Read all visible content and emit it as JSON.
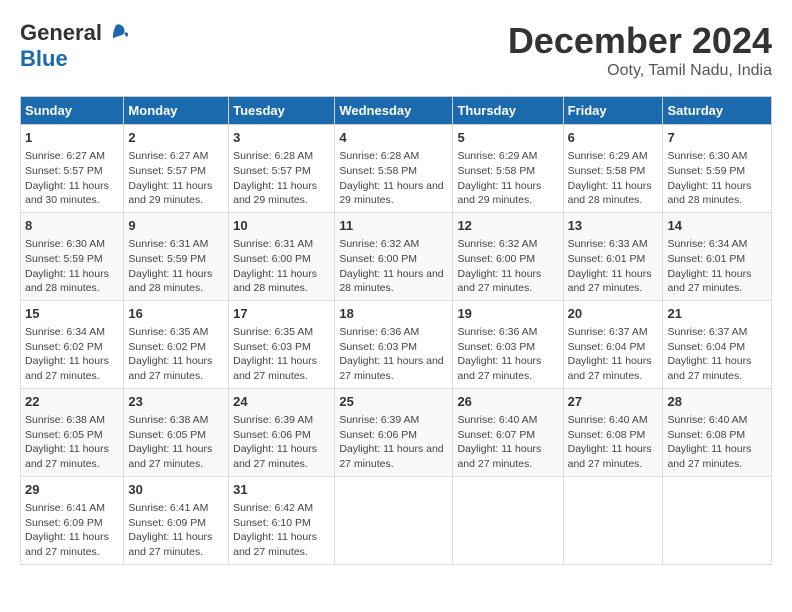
{
  "logo": {
    "general": "General",
    "blue": "Blue"
  },
  "title": "December 2024",
  "location": "Ooty, Tamil Nadu, India",
  "days_of_week": [
    "Sunday",
    "Monday",
    "Tuesday",
    "Wednesday",
    "Thursday",
    "Friday",
    "Saturday"
  ],
  "weeks": [
    [
      {
        "day": "1",
        "sunrise": "Sunrise: 6:27 AM",
        "sunset": "Sunset: 5:57 PM",
        "daylight": "Daylight: 11 hours and 30 minutes."
      },
      {
        "day": "2",
        "sunrise": "Sunrise: 6:27 AM",
        "sunset": "Sunset: 5:57 PM",
        "daylight": "Daylight: 11 hours and 29 minutes."
      },
      {
        "day": "3",
        "sunrise": "Sunrise: 6:28 AM",
        "sunset": "Sunset: 5:57 PM",
        "daylight": "Daylight: 11 hours and 29 minutes."
      },
      {
        "day": "4",
        "sunrise": "Sunrise: 6:28 AM",
        "sunset": "Sunset: 5:58 PM",
        "daylight": "Daylight: 11 hours and 29 minutes."
      },
      {
        "day": "5",
        "sunrise": "Sunrise: 6:29 AM",
        "sunset": "Sunset: 5:58 PM",
        "daylight": "Daylight: 11 hours and 29 minutes."
      },
      {
        "day": "6",
        "sunrise": "Sunrise: 6:29 AM",
        "sunset": "Sunset: 5:58 PM",
        "daylight": "Daylight: 11 hours and 28 minutes."
      },
      {
        "day": "7",
        "sunrise": "Sunrise: 6:30 AM",
        "sunset": "Sunset: 5:59 PM",
        "daylight": "Daylight: 11 hours and 28 minutes."
      }
    ],
    [
      {
        "day": "8",
        "sunrise": "Sunrise: 6:30 AM",
        "sunset": "Sunset: 5:59 PM",
        "daylight": "Daylight: 11 hours and 28 minutes."
      },
      {
        "day": "9",
        "sunrise": "Sunrise: 6:31 AM",
        "sunset": "Sunset: 5:59 PM",
        "daylight": "Daylight: 11 hours and 28 minutes."
      },
      {
        "day": "10",
        "sunrise": "Sunrise: 6:31 AM",
        "sunset": "Sunset: 6:00 PM",
        "daylight": "Daylight: 11 hours and 28 minutes."
      },
      {
        "day": "11",
        "sunrise": "Sunrise: 6:32 AM",
        "sunset": "Sunset: 6:00 PM",
        "daylight": "Daylight: 11 hours and 28 minutes."
      },
      {
        "day": "12",
        "sunrise": "Sunrise: 6:32 AM",
        "sunset": "Sunset: 6:00 PM",
        "daylight": "Daylight: 11 hours and 27 minutes."
      },
      {
        "day": "13",
        "sunrise": "Sunrise: 6:33 AM",
        "sunset": "Sunset: 6:01 PM",
        "daylight": "Daylight: 11 hours and 27 minutes."
      },
      {
        "day": "14",
        "sunrise": "Sunrise: 6:34 AM",
        "sunset": "Sunset: 6:01 PM",
        "daylight": "Daylight: 11 hours and 27 minutes."
      }
    ],
    [
      {
        "day": "15",
        "sunrise": "Sunrise: 6:34 AM",
        "sunset": "Sunset: 6:02 PM",
        "daylight": "Daylight: 11 hours and 27 minutes."
      },
      {
        "day": "16",
        "sunrise": "Sunrise: 6:35 AM",
        "sunset": "Sunset: 6:02 PM",
        "daylight": "Daylight: 11 hours and 27 minutes."
      },
      {
        "day": "17",
        "sunrise": "Sunrise: 6:35 AM",
        "sunset": "Sunset: 6:03 PM",
        "daylight": "Daylight: 11 hours and 27 minutes."
      },
      {
        "day": "18",
        "sunrise": "Sunrise: 6:36 AM",
        "sunset": "Sunset: 6:03 PM",
        "daylight": "Daylight: 11 hours and 27 minutes."
      },
      {
        "day": "19",
        "sunrise": "Sunrise: 6:36 AM",
        "sunset": "Sunset: 6:03 PM",
        "daylight": "Daylight: 11 hours and 27 minutes."
      },
      {
        "day": "20",
        "sunrise": "Sunrise: 6:37 AM",
        "sunset": "Sunset: 6:04 PM",
        "daylight": "Daylight: 11 hours and 27 minutes."
      },
      {
        "day": "21",
        "sunrise": "Sunrise: 6:37 AM",
        "sunset": "Sunset: 6:04 PM",
        "daylight": "Daylight: 11 hours and 27 minutes."
      }
    ],
    [
      {
        "day": "22",
        "sunrise": "Sunrise: 6:38 AM",
        "sunset": "Sunset: 6:05 PM",
        "daylight": "Daylight: 11 hours and 27 minutes."
      },
      {
        "day": "23",
        "sunrise": "Sunrise: 6:38 AM",
        "sunset": "Sunset: 6:05 PM",
        "daylight": "Daylight: 11 hours and 27 minutes."
      },
      {
        "day": "24",
        "sunrise": "Sunrise: 6:39 AM",
        "sunset": "Sunset: 6:06 PM",
        "daylight": "Daylight: 11 hours and 27 minutes."
      },
      {
        "day": "25",
        "sunrise": "Sunrise: 6:39 AM",
        "sunset": "Sunset: 6:06 PM",
        "daylight": "Daylight: 11 hours and 27 minutes."
      },
      {
        "day": "26",
        "sunrise": "Sunrise: 6:40 AM",
        "sunset": "Sunset: 6:07 PM",
        "daylight": "Daylight: 11 hours and 27 minutes."
      },
      {
        "day": "27",
        "sunrise": "Sunrise: 6:40 AM",
        "sunset": "Sunset: 6:08 PM",
        "daylight": "Daylight: 11 hours and 27 minutes."
      },
      {
        "day": "28",
        "sunrise": "Sunrise: 6:40 AM",
        "sunset": "Sunset: 6:08 PM",
        "daylight": "Daylight: 11 hours and 27 minutes."
      }
    ],
    [
      {
        "day": "29",
        "sunrise": "Sunrise: 6:41 AM",
        "sunset": "Sunset: 6:09 PM",
        "daylight": "Daylight: 11 hours and 27 minutes."
      },
      {
        "day": "30",
        "sunrise": "Sunrise: 6:41 AM",
        "sunset": "Sunset: 6:09 PM",
        "daylight": "Daylight: 11 hours and 27 minutes."
      },
      {
        "day": "31",
        "sunrise": "Sunrise: 6:42 AM",
        "sunset": "Sunset: 6:10 PM",
        "daylight": "Daylight: 11 hours and 27 minutes."
      },
      null,
      null,
      null,
      null
    ]
  ]
}
